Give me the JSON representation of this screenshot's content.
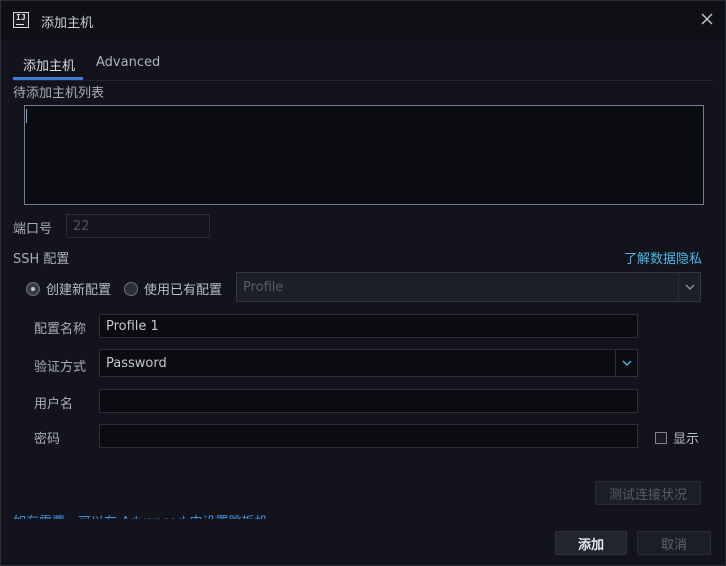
{
  "window": {
    "title": "添加主机",
    "app_icon_text": "IJ",
    "close_icon": "close-icon"
  },
  "tabs": [
    {
      "label": "添加主机",
      "active": true
    },
    {
      "label": "Advanced",
      "active": false
    }
  ],
  "hosts": {
    "label": "待添加主机列表",
    "value": ""
  },
  "port": {
    "label": "端口号",
    "placeholder": "22"
  },
  "ssh": {
    "section_label": "SSH 配置",
    "privacy_link": "了解数据隐私",
    "radio_new": "创建新配置",
    "radio_existing": "使用已有配置",
    "profile_placeholder": "Profile",
    "name_label": "配置名称",
    "name_value": "Profile 1",
    "auth_label": "验证方式",
    "auth_value": "Password",
    "user_label": "用户名",
    "user_value": "",
    "password_label": "密码",
    "password_value": "",
    "show_label": "显示"
  },
  "buttons": {
    "test": "测试连接状况",
    "add": "添加",
    "cancel": "取消"
  },
  "hint": "如有需要，可以在 Advanced 中设置跳板机",
  "colors": {
    "background": "#13141b",
    "accent": "#3d7bd6",
    "link": "#48b8e6"
  }
}
